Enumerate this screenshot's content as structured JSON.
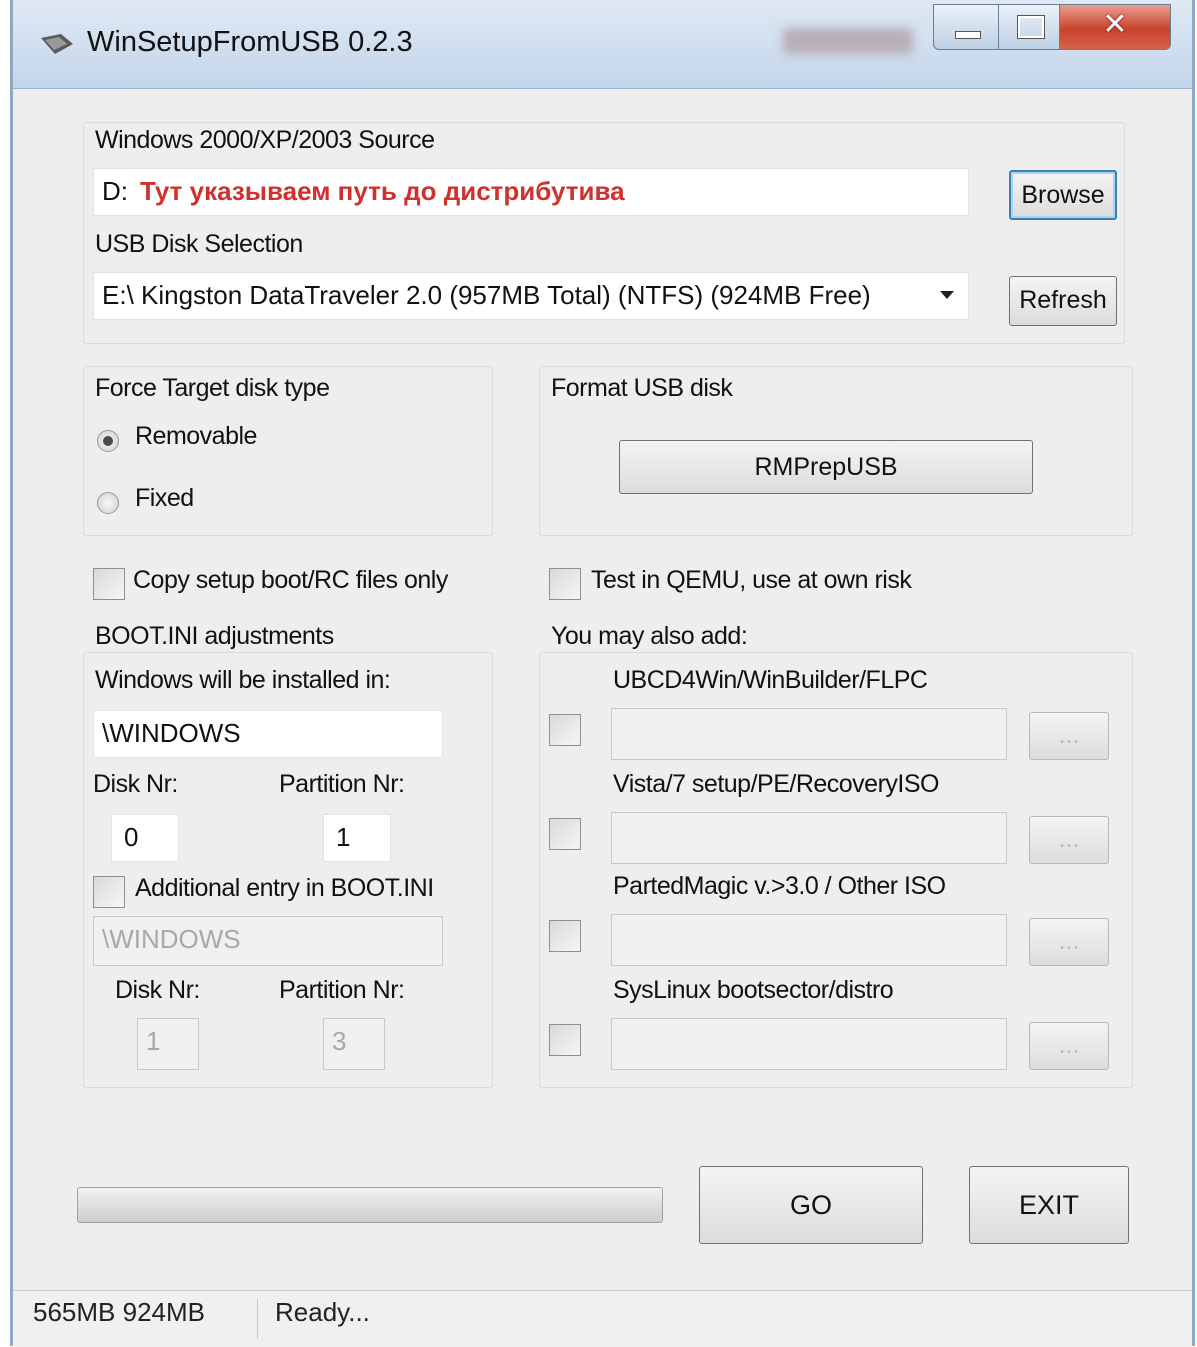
{
  "window": {
    "title": "WinSetupFromUSB 0.2.3",
    "close_glyph": "✕"
  },
  "source": {
    "label": "Windows 2000/XP/2003 Source",
    "value": "D:",
    "hint": "Тут указываем путь до дистрибутива",
    "browse_label": "Browse"
  },
  "usb": {
    "label": "USB Disk Selection",
    "selected": "E:\\ Kingston DataTraveler 2.0 (957MB Total) (NTFS) (924MB Free)",
    "refresh_label": "Refresh"
  },
  "target": {
    "label": "Force Target disk type",
    "options": [
      "Removable",
      "Fixed"
    ],
    "selected": "Removable"
  },
  "format": {
    "label": "Format USB disk",
    "button_label": "RMPrepUSB"
  },
  "copy_setup": {
    "label": "Copy setup boot/RC files only",
    "checked": false
  },
  "qemu": {
    "label": "Test in QEMU, use at own risk",
    "checked": false
  },
  "bootini": {
    "label": "BOOT.INI adjustments",
    "install_label": "Windows will be installed in:",
    "install_value": "\\WINDOWS",
    "disk_label": "Disk Nr:",
    "disk_value": "0",
    "partition_label": "Partition Nr:",
    "partition_value": "1",
    "additional_label": "Additional entry in BOOT.INI",
    "additional_checked": false,
    "additional_value": "\\WINDOWS",
    "additional_disk_label": "Disk Nr:",
    "additional_disk_value": "1",
    "additional_partition_label": "Partition Nr:",
    "additional_partition_value": "3"
  },
  "addons": {
    "label": "You may also add:",
    "browse_label": "...",
    "items": [
      {
        "label": "UBCD4Win/WinBuilder/FLPC",
        "checked": false,
        "value": ""
      },
      {
        "label": "Vista/7 setup/PE/RecoveryISO",
        "checked": false,
        "value": ""
      },
      {
        "label": "PartedMagic v.>3.0 / Other ISO",
        "checked": false,
        "value": ""
      },
      {
        "label": "SysLinux bootsector/distro",
        "checked": false,
        "value": ""
      }
    ]
  },
  "actions": {
    "go_label": "GO",
    "exit_label": "EXIT"
  },
  "progress": {
    "value": 0
  },
  "status": {
    "sizes": "565MB 924MB",
    "message": "Ready..."
  }
}
